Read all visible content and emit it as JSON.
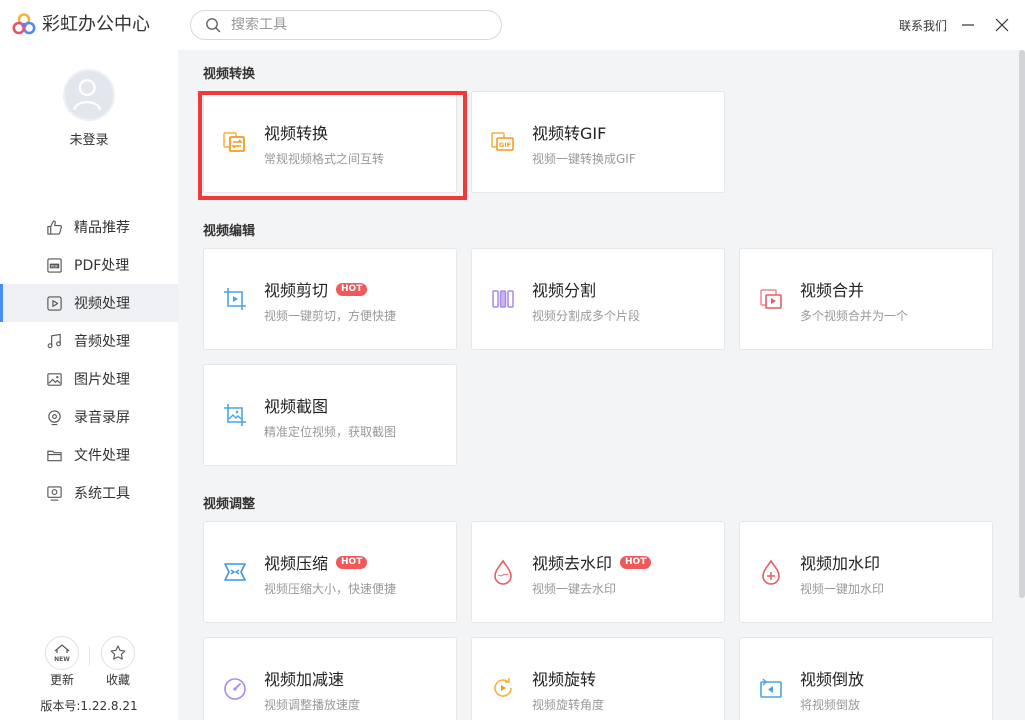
{
  "app": {
    "title": "彩虹办公中心"
  },
  "search": {
    "placeholder": "搜索工具"
  },
  "header": {
    "contact": "联系我们"
  },
  "user": {
    "name": "未登录"
  },
  "sidebar": {
    "items": [
      {
        "label": "精品推荐",
        "icon": "thumbs-up-icon"
      },
      {
        "label": "PDF处理",
        "icon": "pdf-icon"
      },
      {
        "label": "视频处理",
        "icon": "video-icon",
        "active": true
      },
      {
        "label": "音频处理",
        "icon": "music-note-icon"
      },
      {
        "label": "图片处理",
        "icon": "image-icon"
      },
      {
        "label": "录音录屏",
        "icon": "record-icon"
      },
      {
        "label": "文件处理",
        "icon": "folder-icon"
      },
      {
        "label": "系统工具",
        "icon": "system-tool-icon"
      }
    ],
    "update_label": "更新",
    "update_badge": "NEW",
    "favorite_label": "收藏",
    "version": "版本号:1.22.8.21"
  },
  "sections": [
    {
      "title": "视频转换",
      "cards": [
        {
          "title": "视频转换",
          "desc": "常规视频格式之间互转",
          "icon": "video-convert-icon"
        },
        {
          "title": "视频转GIF",
          "desc": "视频一键转换成GIF",
          "icon": "gif-icon",
          "icon_text": "GIF"
        }
      ]
    },
    {
      "title": "视频编辑",
      "cards": [
        {
          "title": "视频剪切",
          "desc": "视频一键剪切，方便快捷",
          "hot": "HOT",
          "icon": "crop-icon"
        },
        {
          "title": "视频分割",
          "desc": "视频分割成多个片段",
          "icon": "split-icon"
        },
        {
          "title": "视频合并",
          "desc": "多个视频合并为一个",
          "icon": "merge-icon"
        },
        {
          "title": "视频截图",
          "desc": "精准定位视频，获取截图",
          "icon": "screenshot-icon"
        }
      ]
    },
    {
      "title": "视频调整",
      "cards": [
        {
          "title": "视频压缩",
          "desc": "视频压缩大小，快速便捷",
          "hot": "HOT",
          "icon": "compress-icon"
        },
        {
          "title": "视频去水印",
          "desc": "视频一键去水印",
          "hot": "HOT",
          "icon": "remove-watermark-icon"
        },
        {
          "title": "视频加水印",
          "desc": "视频一键加水印",
          "icon": "add-watermark-icon"
        },
        {
          "title": "视频加减速",
          "desc": "视频调整播放速度",
          "icon": "speed-icon"
        },
        {
          "title": "视频旋转",
          "desc": "视频旋转角度",
          "icon": "rotate-icon"
        },
        {
          "title": "视频倒放",
          "desc": "将视频倒放",
          "icon": "reverse-icon"
        }
      ]
    }
  ],
  "colors": {
    "accent": "#4a8cf7",
    "hot": "#f2585a",
    "highlight": "#f03a3a"
  }
}
